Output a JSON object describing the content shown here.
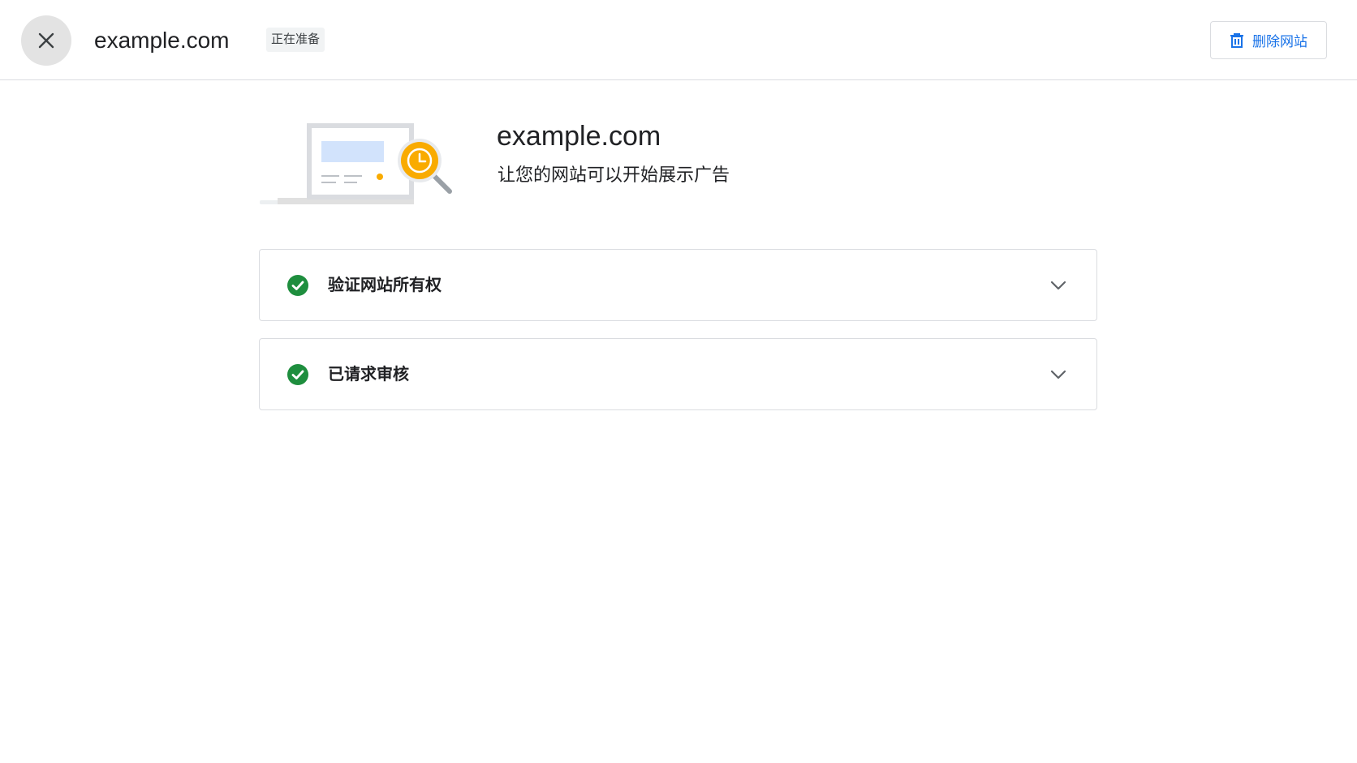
{
  "header": {
    "site_name": "example.com",
    "status": "正在准备",
    "delete_label": "删除网站",
    "close_icon": "close-icon",
    "delete_icon": "trash-icon"
  },
  "hero": {
    "title": "example.com",
    "subtitle": "让您的网站可以开始展示广告",
    "illustration": "laptop-search-clock-illustration"
  },
  "steps": [
    {
      "label": "验证网站所有权",
      "status": "completed",
      "icon": "check-circle-icon"
    },
    {
      "label": "已请求审核",
      "status": "completed",
      "icon": "check-circle-icon"
    }
  ],
  "colors": {
    "accent": "#1a73e8",
    "success": "#1e8e3e",
    "illustration_yellow": "#f9ab00",
    "illustration_blue": "#d2e3fc"
  }
}
